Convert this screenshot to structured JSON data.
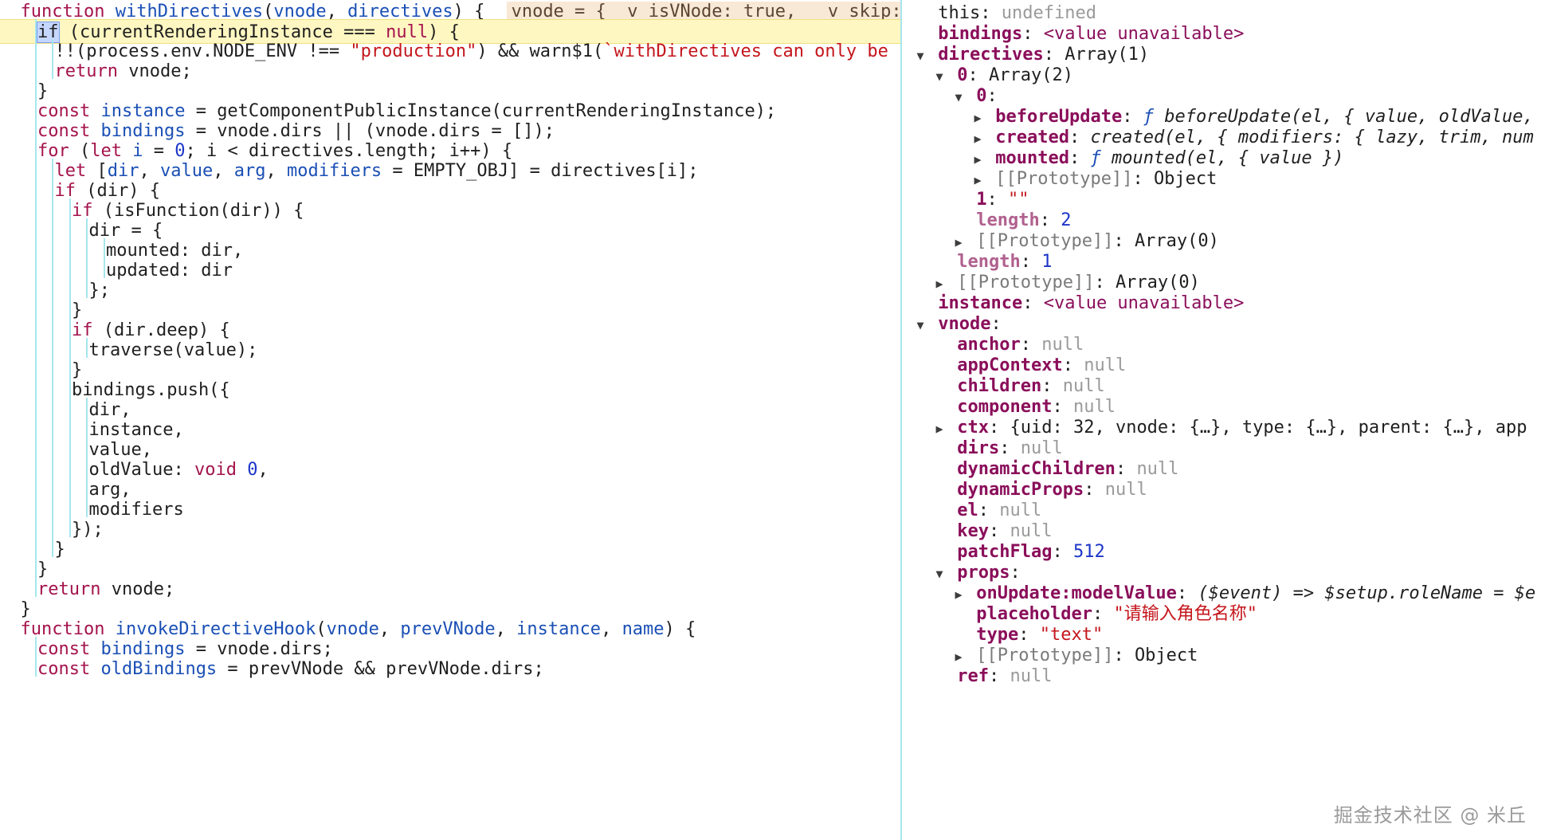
{
  "code_lines": [
    {
      "indent": 1,
      "current": false,
      "segs": [
        [
          "k",
          "function "
        ],
        [
          "v",
          "withDirectives"
        ],
        [
          "p",
          "("
        ],
        [
          "v",
          "vnode"
        ],
        [
          "p",
          ", "
        ],
        [
          "v",
          "directives"
        ],
        [
          "p",
          ") { "
        ]
      ],
      "eval": "vnode = {__v_isVNode: true, __v_skip:"
    },
    {
      "indent": 2,
      "current": true,
      "segs": [
        [
          "hl",
          "if"
        ],
        [
          "p",
          " (currentRenderingInstance === "
        ],
        [
          "k",
          "null"
        ],
        [
          "p",
          ") {"
        ]
      ]
    },
    {
      "indent": 3,
      "current": false,
      "segs": [
        [
          "p",
          "!!(process.env.NODE_ENV !== "
        ],
        [
          "s",
          "\"production\""
        ],
        [
          "p",
          ") && warn$1("
        ],
        [
          "s",
          "`withDirectives can only be"
        ]
      ]
    },
    {
      "indent": 3,
      "current": false,
      "segs": [
        [
          "k",
          "return "
        ],
        [
          "p",
          "vnode;"
        ]
      ]
    },
    {
      "indent": 2,
      "current": false,
      "segs": [
        [
          "p",
          "}"
        ]
      ]
    },
    {
      "indent": 2,
      "current": false,
      "segs": [
        [
          "k",
          "const "
        ],
        [
          "v",
          "instance"
        ],
        [
          "p",
          " = getComponentPublicInstance(currentRenderingInstance);"
        ]
      ]
    },
    {
      "indent": 2,
      "current": false,
      "segs": [
        [
          "k",
          "const "
        ],
        [
          "v",
          "bindings"
        ],
        [
          "p",
          " = vnode.dirs || (vnode.dirs = []);"
        ]
      ]
    },
    {
      "indent": 2,
      "current": false,
      "segs": [
        [
          "k",
          "for "
        ],
        [
          "p",
          "("
        ],
        [
          "k",
          "let "
        ],
        [
          "v",
          "i"
        ],
        [
          "p",
          " = "
        ],
        [
          "num",
          "0"
        ],
        [
          "p",
          "; i < directives.length; i++) {"
        ]
      ]
    },
    {
      "indent": 3,
      "current": false,
      "segs": [
        [
          "k",
          "let "
        ],
        [
          "p",
          "["
        ],
        [
          "v",
          "dir"
        ],
        [
          "p",
          ", "
        ],
        [
          "v",
          "value"
        ],
        [
          "p",
          ", "
        ],
        [
          "v",
          "arg"
        ],
        [
          "p",
          ", "
        ],
        [
          "v",
          "modifiers"
        ],
        [
          "p",
          " = EMPTY_OBJ] = directives[i];"
        ]
      ]
    },
    {
      "indent": 3,
      "current": false,
      "segs": [
        [
          "k",
          "if "
        ],
        [
          "p",
          "(dir) {"
        ]
      ]
    },
    {
      "indent": 4,
      "current": false,
      "segs": [
        [
          "k",
          "if "
        ],
        [
          "p",
          "(isFunction(dir)) {"
        ]
      ]
    },
    {
      "indent": 5,
      "current": false,
      "segs": [
        [
          "p",
          "dir = {"
        ]
      ]
    },
    {
      "indent": 6,
      "current": false,
      "segs": [
        [
          "p",
          "mounted: dir,"
        ]
      ]
    },
    {
      "indent": 6,
      "current": false,
      "segs": [
        [
          "p",
          "updated: dir"
        ]
      ]
    },
    {
      "indent": 5,
      "current": false,
      "segs": [
        [
          "p",
          "};"
        ]
      ]
    },
    {
      "indent": 4,
      "current": false,
      "segs": [
        [
          "p",
          "}"
        ]
      ]
    },
    {
      "indent": 4,
      "current": false,
      "segs": [
        [
          "k",
          "if "
        ],
        [
          "p",
          "(dir.deep) {"
        ]
      ]
    },
    {
      "indent": 5,
      "current": false,
      "segs": [
        [
          "p",
          "traverse(value);"
        ]
      ]
    },
    {
      "indent": 4,
      "current": false,
      "segs": [
        [
          "p",
          "}"
        ]
      ]
    },
    {
      "indent": 4,
      "current": false,
      "segs": [
        [
          "p",
          "bindings.push({"
        ]
      ]
    },
    {
      "indent": 5,
      "current": false,
      "segs": [
        [
          "p",
          "dir,"
        ]
      ]
    },
    {
      "indent": 5,
      "current": false,
      "segs": [
        [
          "p",
          "instance,"
        ]
      ]
    },
    {
      "indent": 5,
      "current": false,
      "segs": [
        [
          "p",
          "value,"
        ]
      ]
    },
    {
      "indent": 5,
      "current": false,
      "segs": [
        [
          "p",
          "oldValue: "
        ],
        [
          "k",
          "void "
        ],
        [
          "num",
          "0"
        ],
        [
          "p",
          ","
        ]
      ]
    },
    {
      "indent": 5,
      "current": false,
      "segs": [
        [
          "p",
          "arg,"
        ]
      ]
    },
    {
      "indent": 5,
      "current": false,
      "segs": [
        [
          "p",
          "modifiers"
        ]
      ]
    },
    {
      "indent": 4,
      "current": false,
      "segs": [
        [
          "p",
          "});"
        ]
      ]
    },
    {
      "indent": 3,
      "current": false,
      "segs": [
        [
          "p",
          "}"
        ]
      ]
    },
    {
      "indent": 2,
      "current": false,
      "segs": [
        [
          "p",
          "}"
        ]
      ]
    },
    {
      "indent": 2,
      "current": false,
      "segs": [
        [
          "k",
          "return "
        ],
        [
          "p",
          "vnode;"
        ]
      ]
    },
    {
      "indent": 1,
      "current": false,
      "segs": [
        [
          "p",
          "}"
        ]
      ]
    },
    {
      "indent": 1,
      "current": false,
      "segs": [
        [
          "k",
          "function "
        ],
        [
          "v",
          "invokeDirectiveHook"
        ],
        [
          "p",
          "("
        ],
        [
          "v",
          "vnode"
        ],
        [
          "p",
          ", "
        ],
        [
          "v",
          "prevVNode"
        ],
        [
          "p",
          ", "
        ],
        [
          "v",
          "instance"
        ],
        [
          "p",
          ", "
        ],
        [
          "v",
          "name"
        ],
        [
          "p",
          ") {"
        ]
      ]
    },
    {
      "indent": 2,
      "current": false,
      "segs": [
        [
          "k",
          "const "
        ],
        [
          "v",
          "bindings"
        ],
        [
          "p",
          " = vnode.dirs;"
        ]
      ]
    },
    {
      "indent": 2,
      "current": false,
      "segs": [
        [
          "k",
          "const "
        ],
        [
          "v",
          "oldBindings"
        ],
        [
          "p",
          " = prevVNode && prevVNode.dirs;"
        ]
      ]
    }
  ],
  "scope_rows": [
    {
      "depth": 0,
      "toggle": "none",
      "key": "this",
      "keystyle": "plain",
      "value": "undefined",
      "valstyle": "null"
    },
    {
      "depth": 0,
      "toggle": "none",
      "key": "bindings",
      "keystyle": "bold",
      "value": "<value unavailable>",
      "valstyle": "unavail"
    },
    {
      "depth": 0,
      "toggle": "open",
      "key": "directives",
      "keystyle": "bold",
      "value": "Array(1)",
      "valstyle": "plain"
    },
    {
      "depth": 1,
      "toggle": "open",
      "key": "0",
      "keystyle": "bold",
      "value": "Array(2)",
      "valstyle": "plain"
    },
    {
      "depth": 2,
      "toggle": "open",
      "key": "0",
      "keystyle": "bold",
      "value": "",
      "valstyle": "plain"
    },
    {
      "depth": 3,
      "toggle": "closed",
      "key": "beforeUpdate",
      "keystyle": "bold",
      "value": "beforeUpdate(el, { value, oldValue,",
      "valstyle": "fn",
      "fmark": "ƒ "
    },
    {
      "depth": 3,
      "toggle": "closed",
      "key": "created",
      "keystyle": "bold",
      "value": "created(el, { modifiers: { lazy, trim, num",
      "valstyle": "fn",
      "fmark": ""
    },
    {
      "depth": 3,
      "toggle": "closed",
      "key": "mounted",
      "keystyle": "bold",
      "value": "mounted(el, { value })",
      "valstyle": "fn",
      "fmark": "ƒ "
    },
    {
      "depth": 3,
      "toggle": "closed",
      "key": "[[Prototype]]",
      "keystyle": "gray",
      "value": "Object",
      "valstyle": "plain"
    },
    {
      "depth": 2,
      "toggle": "none",
      "key": "1",
      "keystyle": "bold",
      "value": "\"\"",
      "valstyle": "str"
    },
    {
      "depth": 2,
      "toggle": "none",
      "key": "length",
      "keystyle": "dim",
      "value": "2",
      "valstyle": "num"
    },
    {
      "depth": 2,
      "toggle": "closed",
      "key": "[[Prototype]]",
      "keystyle": "gray",
      "value": "Array(0)",
      "valstyle": "plain"
    },
    {
      "depth": 1,
      "toggle": "none",
      "key": "length",
      "keystyle": "dim",
      "value": "1",
      "valstyle": "num"
    },
    {
      "depth": 1,
      "toggle": "closed",
      "key": "[[Prototype]]",
      "keystyle": "gray",
      "value": "Array(0)",
      "valstyle": "plain"
    },
    {
      "depth": 0,
      "toggle": "none",
      "key": "instance",
      "keystyle": "bold",
      "value": "<value unavailable>",
      "valstyle": "unavail"
    },
    {
      "depth": 0,
      "toggle": "open",
      "key": "vnode",
      "keystyle": "bold",
      "value": "",
      "valstyle": "plain"
    },
    {
      "depth": 1,
      "toggle": "none",
      "key": "anchor",
      "keystyle": "bold",
      "value": "null",
      "valstyle": "null"
    },
    {
      "depth": 1,
      "toggle": "none",
      "key": "appContext",
      "keystyle": "bold",
      "value": "null",
      "valstyle": "null"
    },
    {
      "depth": 1,
      "toggle": "none",
      "key": "children",
      "keystyle": "bold",
      "value": "null",
      "valstyle": "null"
    },
    {
      "depth": 1,
      "toggle": "none",
      "key": "component",
      "keystyle": "bold",
      "value": "null",
      "valstyle": "null"
    },
    {
      "depth": 1,
      "toggle": "closed",
      "key": "ctx",
      "keystyle": "bold",
      "value": "{uid: 32, vnode: {…}, type: {…}, parent: {…}, app",
      "valstyle": "plain"
    },
    {
      "depth": 1,
      "toggle": "none",
      "key": "dirs",
      "keystyle": "bold",
      "value": "null",
      "valstyle": "null"
    },
    {
      "depth": 1,
      "toggle": "none",
      "key": "dynamicChildren",
      "keystyle": "bold",
      "value": "null",
      "valstyle": "null"
    },
    {
      "depth": 1,
      "toggle": "none",
      "key": "dynamicProps",
      "keystyle": "bold",
      "value": "null",
      "valstyle": "null"
    },
    {
      "depth": 1,
      "toggle": "none",
      "key": "el",
      "keystyle": "bold",
      "value": "null",
      "valstyle": "null"
    },
    {
      "depth": 1,
      "toggle": "none",
      "key": "key",
      "keystyle": "bold",
      "value": "null",
      "valstyle": "null"
    },
    {
      "depth": 1,
      "toggle": "none",
      "key": "patchFlag",
      "keystyle": "bold",
      "value": "512",
      "valstyle": "num"
    },
    {
      "depth": 1,
      "toggle": "open",
      "key": "props",
      "keystyle": "bold",
      "value": "",
      "valstyle": "plain"
    },
    {
      "depth": 2,
      "toggle": "closed",
      "key": "onUpdate:modelValue",
      "keystyle": "bold",
      "value": "($event) => $setup.roleName = $e",
      "valstyle": "fn",
      "fmark": ""
    },
    {
      "depth": 2,
      "toggle": "none",
      "key": "placeholder",
      "keystyle": "bold",
      "value": "\"请输入角色名称\"",
      "valstyle": "str"
    },
    {
      "depth": 2,
      "toggle": "none",
      "key": "type",
      "keystyle": "bold",
      "value": "\"text\"",
      "valstyle": "str"
    },
    {
      "depth": 2,
      "toggle": "closed",
      "key": "[[Prototype]]",
      "keystyle": "gray",
      "value": "Object",
      "valstyle": "plain"
    },
    {
      "depth": 1,
      "toggle": "none",
      "key": "ref",
      "keystyle": "bold",
      "value": "null",
      "valstyle": "null"
    }
  ],
  "watermark": "掘金技术社区 @ 米丘",
  "icons": {
    "expanded": "triangle-down-icon",
    "collapsed": "triangle-right-icon"
  },
  "colors": {
    "current_line": "#fff7c2",
    "guide": "#a6e6ee",
    "keyword": "#a4134c",
    "string": "#c4161c"
  }
}
